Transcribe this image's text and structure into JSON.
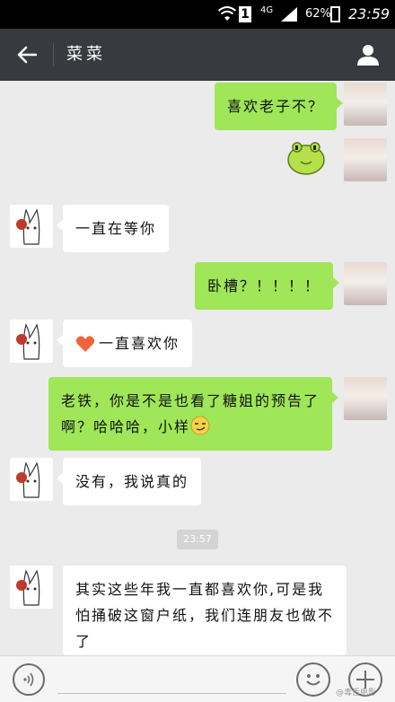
{
  "statusbar": {
    "network": "4G",
    "battery": "62%",
    "time": "23:59",
    "sim": "1"
  },
  "header": {
    "title": "菜菜"
  },
  "messages": [
    {
      "side": "right",
      "kind": "text",
      "text": "喜欢老子不？"
    },
    {
      "side": "right",
      "kind": "sticker",
      "sticker": "green-blob-sticker"
    },
    {
      "side": "left",
      "kind": "text",
      "text": "一直在等你"
    },
    {
      "side": "right",
      "kind": "text",
      "text": "卧槽？！！！！"
    },
    {
      "side": "left",
      "kind": "text",
      "emoji": "heart",
      "text": "一直喜欢你"
    },
    {
      "side": "right",
      "kind": "text",
      "text": "老铁，你是不是也看了糖姐的预告了啊？哈哈哈，小样",
      "emoji": "smirk"
    },
    {
      "side": "left",
      "kind": "text",
      "text": "没有，我说真的"
    },
    {
      "kind": "timestamp",
      "text": "23:57"
    },
    {
      "side": "left",
      "kind": "text",
      "text": "其实这些年我一直都喜欢你,可是我怕捅破这窗户纸，我们连朋友也做不了"
    }
  ],
  "watermark": "@毒舌电影"
}
